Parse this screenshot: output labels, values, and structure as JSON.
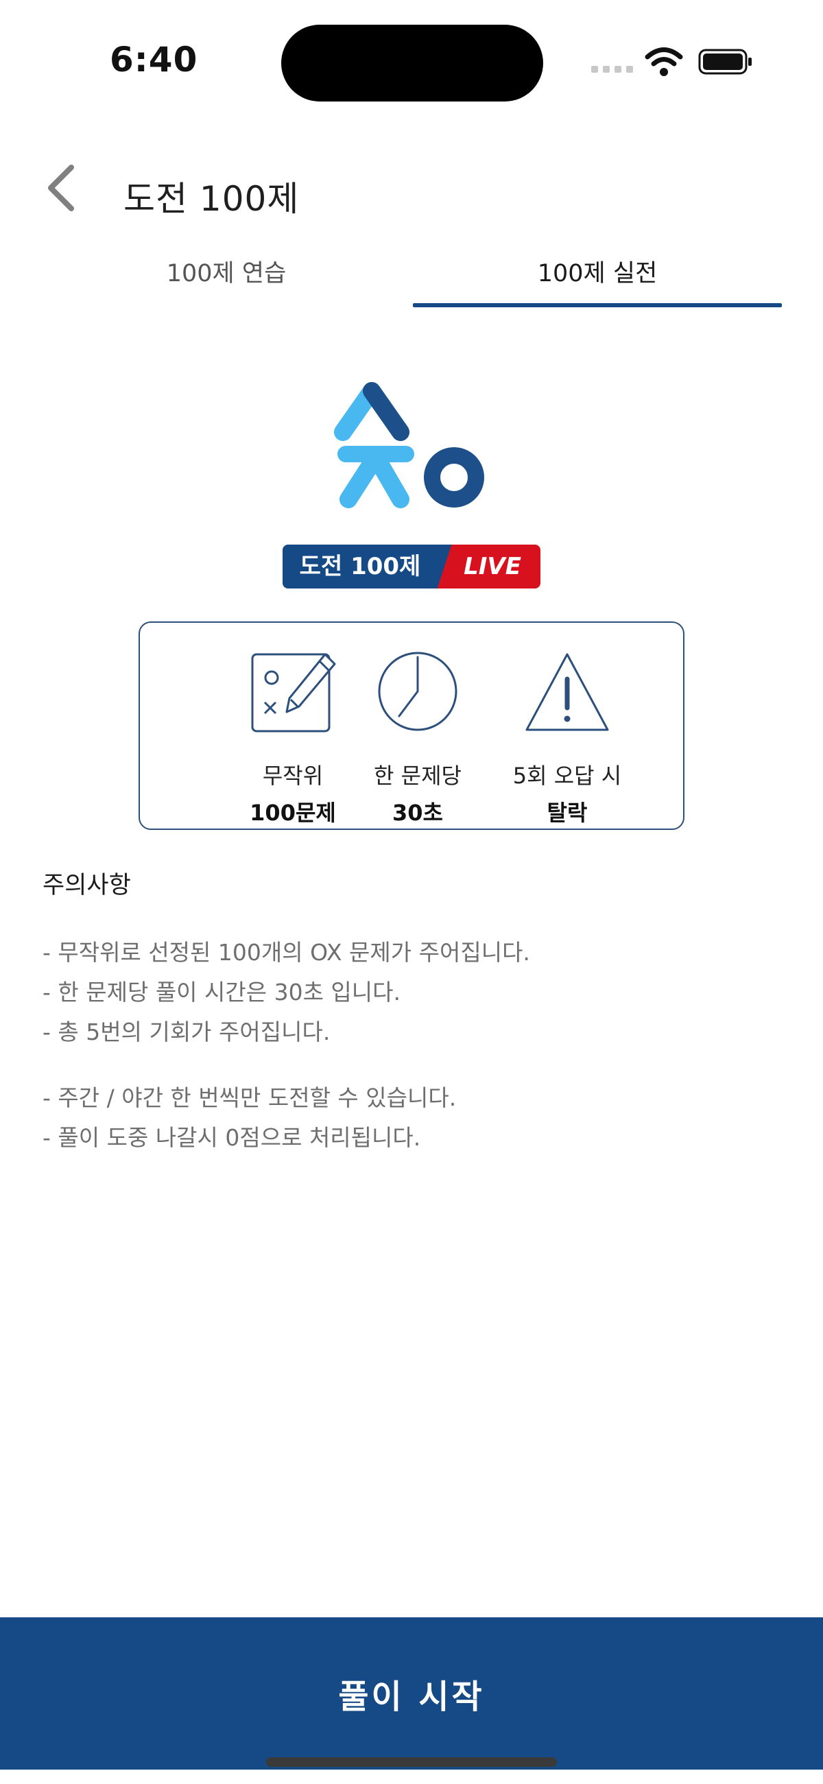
{
  "status_bar": {
    "time": "6:40"
  },
  "header": {
    "title": "도전 100제"
  },
  "tabs": [
    {
      "label": "100제 연습",
      "active": false
    },
    {
      "label": "100제 실전",
      "active": true
    }
  ],
  "banner": {
    "left": "도전 100제",
    "right": "LIVE"
  },
  "info": [
    {
      "line1": "무작위",
      "line2": "100문제",
      "icon": "ox-pencil-icon"
    },
    {
      "line1": "한 문제당",
      "line2": "30초",
      "icon": "clock-icon"
    },
    {
      "line1": "5회 오답 시",
      "line2": "탈락",
      "icon": "warning-icon"
    }
  ],
  "notice": {
    "title": "주의사항",
    "group1": [
      "- 무작위로 선정된 100개의 OX 문제가 주어집니다.",
      "- 한 문제당 풀이 시간은 30초 입니다.",
      "- 총 5번의 기회가 주어집니다."
    ],
    "group2": [
      "- 주간 / 야간 한 번씩만 도전할 수 있습니다.",
      "- 풀이 도중 나갈시 0점으로 처리됩니다."
    ]
  },
  "start_button": {
    "label": "풀이 시작"
  },
  "colors": {
    "primary": "#154a86",
    "live_red": "#d7121e",
    "logo_light_blue": "#49b8f0",
    "logo_dark_blue": "#1d4f8a"
  }
}
